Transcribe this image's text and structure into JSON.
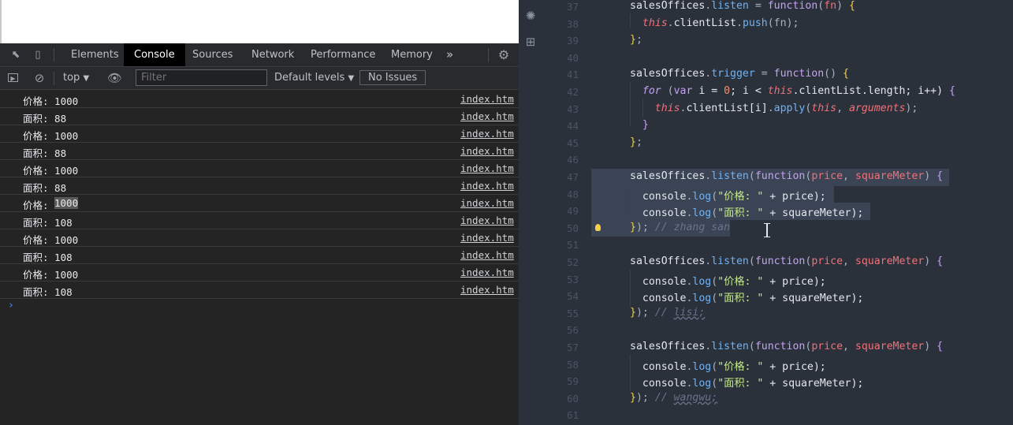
{
  "devtools": {
    "tabs": [
      "Elements",
      "Console",
      "Sources",
      "Network",
      "Performance",
      "Memory"
    ],
    "active_tab": "Console",
    "more_tabs": "»",
    "toolbar": {
      "context": "top",
      "filter_placeholder": "Filter",
      "levels": "Default levels",
      "issues": "No Issues"
    },
    "logs": [
      {
        "text": "价格: 1000",
        "source": "index.htm"
      },
      {
        "text": "面积: 88",
        "source": "index.htm"
      },
      {
        "text": "价格: 1000",
        "source": "index.htm"
      },
      {
        "text": "面积: 88",
        "source": "index.htm"
      },
      {
        "text": "价格: 1000",
        "source": "index.htm"
      },
      {
        "text": "面积: 88",
        "source": "index.htm"
      },
      {
        "text": "价格: ",
        "highlight": "1000",
        "source": "index.htm"
      },
      {
        "text": "面积: 108",
        "source": "index.htm"
      },
      {
        "text": "价格: 1000",
        "source": "index.htm"
      },
      {
        "text": "面积: 108",
        "source": "index.htm"
      },
      {
        "text": "价格: 1000",
        "source": "index.htm"
      },
      {
        "text": "面积: 108",
        "source": "index.htm"
      }
    ],
    "prompt": "›"
  },
  "editor": {
    "lines": [
      {
        "n": "37",
        "indent": 2,
        "tokens": [
          [
            "salesOffices",
            "obj"
          ],
          [
            ".",
            "punc"
          ],
          [
            "listen",
            "prop"
          ],
          [
            " = ",
            "punc"
          ],
          [
            "function",
            "fn"
          ],
          [
            "(",
            "punc"
          ],
          [
            "fn",
            "par"
          ],
          [
            ") ",
            "punc"
          ],
          [
            "{",
            "brace"
          ]
        ]
      },
      {
        "n": "38",
        "indent": 3,
        "tokens": [
          [
            "this",
            "this"
          ],
          [
            ".",
            "punc"
          ],
          [
            "clientList",
            "obj"
          ],
          [
            ".",
            "punc"
          ],
          [
            "push",
            "prop"
          ],
          [
            "(fn);",
            "punc"
          ]
        ]
      },
      {
        "n": "39",
        "indent": 2,
        "tokens": [
          [
            "}",
            "brace"
          ],
          [
            ";",
            "punc"
          ]
        ]
      },
      {
        "n": "40",
        "indent": 0,
        "tokens": []
      },
      {
        "n": "41",
        "indent": 2,
        "tokens": [
          [
            "salesOffices",
            "obj"
          ],
          [
            ".",
            "punc"
          ],
          [
            "trigger",
            "prop"
          ],
          [
            " = ",
            "punc"
          ],
          [
            "function",
            "fn"
          ],
          [
            "() ",
            "punc"
          ],
          [
            "{",
            "brace"
          ]
        ]
      },
      {
        "n": "42",
        "indent": 3,
        "tokens": [
          [
            "for",
            "kw"
          ],
          [
            " (",
            "punc"
          ],
          [
            "var",
            "fn"
          ],
          [
            " i = ",
            "obj"
          ],
          [
            "0",
            "num"
          ],
          [
            "; i < ",
            "obj"
          ],
          [
            "this",
            "this"
          ],
          [
            ".clientList.length; i++) ",
            "obj"
          ],
          [
            "{",
            "fn"
          ]
        ]
      },
      {
        "n": "43",
        "indent": 4,
        "tokens": [
          [
            "this",
            "this"
          ],
          [
            ".",
            "punc"
          ],
          [
            "clientList[i]",
            "obj"
          ],
          [
            ".",
            "punc"
          ],
          [
            "apply",
            "prop"
          ],
          [
            "(",
            "punc"
          ],
          [
            "this",
            "this"
          ],
          [
            ", ",
            "punc"
          ],
          [
            "arguments",
            "arg"
          ],
          [
            ");",
            "punc"
          ]
        ]
      },
      {
        "n": "44",
        "indent": 3,
        "tokens": [
          [
            "}",
            "fn"
          ]
        ]
      },
      {
        "n": "45",
        "indent": 2,
        "tokens": [
          [
            "}",
            "brace"
          ],
          [
            ";",
            "punc"
          ]
        ]
      },
      {
        "n": "46",
        "indent": 0,
        "tokens": []
      },
      {
        "n": "47",
        "indent": 2,
        "tokens": [
          [
            "salesOffices",
            "obj"
          ],
          [
            ".",
            "punc"
          ],
          [
            "listen",
            "prop"
          ],
          [
            "(",
            "punc"
          ],
          [
            "function",
            "fn"
          ],
          [
            "(",
            "punc"
          ],
          [
            "price",
            "par"
          ],
          [
            ", ",
            "punc"
          ],
          [
            "squareMeter",
            "par"
          ],
          [
            ") ",
            "punc"
          ],
          [
            "{",
            "fn"
          ]
        ]
      },
      {
        "n": "48",
        "indent": 3,
        "tokens": [
          [
            "console",
            "obj"
          ],
          [
            ".",
            "punc"
          ],
          [
            "log",
            "prop"
          ],
          [
            "(",
            "punc"
          ],
          [
            "\"价格: \"",
            "str"
          ],
          [
            " + price);",
            "obj"
          ]
        ]
      },
      {
        "n": "49",
        "indent": 3,
        "tokens": [
          [
            "console",
            "obj"
          ],
          [
            ".",
            "punc"
          ],
          [
            "log",
            "prop"
          ],
          [
            "(",
            "punc"
          ],
          [
            "\"面积: \"",
            "str"
          ],
          [
            " + squareMeter);",
            "obj"
          ]
        ]
      },
      {
        "n": "50",
        "indent": 2,
        "tokens": [
          [
            "}",
            "brace"
          ],
          [
            "); ",
            "punc"
          ],
          [
            "// zhang san",
            "com"
          ]
        ]
      },
      {
        "n": "51",
        "indent": 0,
        "tokens": []
      },
      {
        "n": "52",
        "indent": 2,
        "tokens": [
          [
            "salesOffices",
            "obj"
          ],
          [
            ".",
            "punc"
          ],
          [
            "listen",
            "prop"
          ],
          [
            "(",
            "punc"
          ],
          [
            "function",
            "fn"
          ],
          [
            "(",
            "punc"
          ],
          [
            "price",
            "par"
          ],
          [
            ", ",
            "punc"
          ],
          [
            "squareMeter",
            "par"
          ],
          [
            ") ",
            "punc"
          ],
          [
            "{",
            "fn"
          ]
        ]
      },
      {
        "n": "53",
        "indent": 3,
        "tokens": [
          [
            "console",
            "obj"
          ],
          [
            ".",
            "punc"
          ],
          [
            "log",
            "prop"
          ],
          [
            "(",
            "punc"
          ],
          [
            "\"价格: \"",
            "str"
          ],
          [
            " + price);",
            "obj"
          ]
        ]
      },
      {
        "n": "54",
        "indent": 3,
        "tokens": [
          [
            "console",
            "obj"
          ],
          [
            ".",
            "punc"
          ],
          [
            "log",
            "prop"
          ],
          [
            "(",
            "punc"
          ],
          [
            "\"面积: \"",
            "str"
          ],
          [
            " + squareMeter);",
            "obj"
          ]
        ]
      },
      {
        "n": "55",
        "indent": 2,
        "tokens": [
          [
            "}",
            "brace"
          ],
          [
            "); ",
            "punc"
          ],
          [
            "// ",
            "com"
          ],
          [
            "lisi;",
            "comsq"
          ]
        ]
      },
      {
        "n": "56",
        "indent": 0,
        "tokens": []
      },
      {
        "n": "57",
        "indent": 2,
        "tokens": [
          [
            "salesOffices",
            "obj"
          ],
          [
            ".",
            "punc"
          ],
          [
            "listen",
            "prop"
          ],
          [
            "(",
            "punc"
          ],
          [
            "function",
            "fn"
          ],
          [
            "(",
            "punc"
          ],
          [
            "price",
            "par"
          ],
          [
            ", ",
            "punc"
          ],
          [
            "squareMeter",
            "par"
          ],
          [
            ") ",
            "punc"
          ],
          [
            "{",
            "fn"
          ]
        ]
      },
      {
        "n": "58",
        "indent": 3,
        "tokens": [
          [
            "console",
            "obj"
          ],
          [
            ".",
            "punc"
          ],
          [
            "log",
            "prop"
          ],
          [
            "(",
            "punc"
          ],
          [
            "\"价格: \"",
            "str"
          ],
          [
            " + price);",
            "obj"
          ]
        ]
      },
      {
        "n": "59",
        "indent": 3,
        "tokens": [
          [
            "console",
            "obj"
          ],
          [
            ".",
            "punc"
          ],
          [
            "log",
            "prop"
          ],
          [
            "(",
            "punc"
          ],
          [
            "\"面积: \"",
            "str"
          ],
          [
            " + squareMeter);",
            "obj"
          ]
        ]
      },
      {
        "n": "60",
        "indent": 2,
        "tokens": [
          [
            "}",
            "brace"
          ],
          [
            "); ",
            "punc"
          ],
          [
            "// ",
            "com"
          ],
          [
            "wangwu;",
            "comsq"
          ]
        ]
      },
      {
        "n": "61",
        "indent": 0,
        "tokens": []
      }
    ]
  }
}
